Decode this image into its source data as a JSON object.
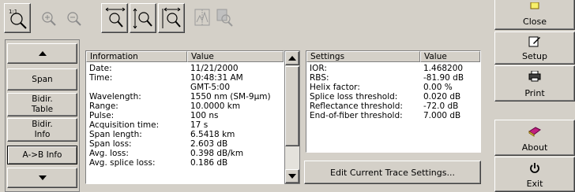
{
  "left_nav": {
    "span": "Span",
    "bidir_table": "Bidir.\nTable",
    "bidir_info": "Bidir.\nInfo",
    "a_to_b_info": "A->B Info"
  },
  "info_table": {
    "headers": [
      "Information",
      "Value"
    ],
    "rows": [
      [
        "Date:",
        "11/21/2000"
      ],
      [
        "Time:",
        "10:48:31 AM"
      ],
      [
        "",
        "GMT-5:00"
      ],
      [
        "Wavelength:",
        "1550 nm (SM-9µm)"
      ],
      [
        "Range:",
        "10.0000 km"
      ],
      [
        "Pulse:",
        "100 ns"
      ],
      [
        "Acquisition time:",
        "17 s"
      ],
      [
        "Span length:",
        "6.5418 km"
      ],
      [
        "Span loss:",
        "2.603 dB"
      ],
      [
        "Avg. loss:",
        "0.398 dB/km"
      ],
      [
        "Avg. splice loss:",
        "0.186 dB"
      ]
    ]
  },
  "settings_table": {
    "headers": [
      "Settings",
      "Value"
    ],
    "rows": [
      [
        "IOR:",
        "1.468200"
      ],
      [
        "RBS:",
        "-81.90 dB"
      ],
      [
        "Helix factor:",
        "0.00 %"
      ],
      [
        "Splice loss threshold:",
        "0.020 dB"
      ],
      [
        "Reflectance threshold:",
        "-72.0 dB"
      ],
      [
        "End-of-fiber threshold:",
        "7.000 dB"
      ]
    ]
  },
  "edit_button": "Edit Current Trace Settings...",
  "right_buttons": {
    "close": "Close",
    "setup": "Setup",
    "print": "Print",
    "about": "About",
    "exit": "Exit"
  },
  "toolbar_icons": [
    "zoom-1to1-icon",
    "zoom-in-icon",
    "zoom-out-icon",
    "fit-both-icon",
    "fit-vertical-icon",
    "fit-horizontal-icon",
    "zoom-marker-icon",
    "zoom-region-icon"
  ]
}
